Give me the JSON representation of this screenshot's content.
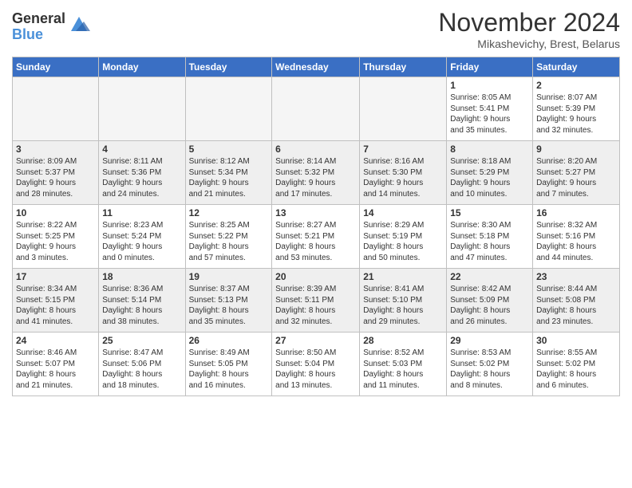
{
  "logo": {
    "general": "General",
    "blue": "Blue"
  },
  "header": {
    "month": "November 2024",
    "location": "Mikashevichy, Brest, Belarus"
  },
  "weekdays": [
    "Sunday",
    "Monday",
    "Tuesday",
    "Wednesday",
    "Thursday",
    "Friday",
    "Saturday"
  ],
  "weeks": [
    [
      {
        "day": "",
        "info": ""
      },
      {
        "day": "",
        "info": ""
      },
      {
        "day": "",
        "info": ""
      },
      {
        "day": "",
        "info": ""
      },
      {
        "day": "",
        "info": ""
      },
      {
        "day": "1",
        "info": "Sunrise: 8:05 AM\nSunset: 5:41 PM\nDaylight: 9 hours\nand 35 minutes."
      },
      {
        "day": "2",
        "info": "Sunrise: 8:07 AM\nSunset: 5:39 PM\nDaylight: 9 hours\nand 32 minutes."
      }
    ],
    [
      {
        "day": "3",
        "info": "Sunrise: 8:09 AM\nSunset: 5:37 PM\nDaylight: 9 hours\nand 28 minutes."
      },
      {
        "day": "4",
        "info": "Sunrise: 8:11 AM\nSunset: 5:36 PM\nDaylight: 9 hours\nand 24 minutes."
      },
      {
        "day": "5",
        "info": "Sunrise: 8:12 AM\nSunset: 5:34 PM\nDaylight: 9 hours\nand 21 minutes."
      },
      {
        "day": "6",
        "info": "Sunrise: 8:14 AM\nSunset: 5:32 PM\nDaylight: 9 hours\nand 17 minutes."
      },
      {
        "day": "7",
        "info": "Sunrise: 8:16 AM\nSunset: 5:30 PM\nDaylight: 9 hours\nand 14 minutes."
      },
      {
        "day": "8",
        "info": "Sunrise: 8:18 AM\nSunset: 5:29 PM\nDaylight: 9 hours\nand 10 minutes."
      },
      {
        "day": "9",
        "info": "Sunrise: 8:20 AM\nSunset: 5:27 PM\nDaylight: 9 hours\nand 7 minutes."
      }
    ],
    [
      {
        "day": "10",
        "info": "Sunrise: 8:22 AM\nSunset: 5:25 PM\nDaylight: 9 hours\nand 3 minutes."
      },
      {
        "day": "11",
        "info": "Sunrise: 8:23 AM\nSunset: 5:24 PM\nDaylight: 9 hours\nand 0 minutes."
      },
      {
        "day": "12",
        "info": "Sunrise: 8:25 AM\nSunset: 5:22 PM\nDaylight: 8 hours\nand 57 minutes."
      },
      {
        "day": "13",
        "info": "Sunrise: 8:27 AM\nSunset: 5:21 PM\nDaylight: 8 hours\nand 53 minutes."
      },
      {
        "day": "14",
        "info": "Sunrise: 8:29 AM\nSunset: 5:19 PM\nDaylight: 8 hours\nand 50 minutes."
      },
      {
        "day": "15",
        "info": "Sunrise: 8:30 AM\nSunset: 5:18 PM\nDaylight: 8 hours\nand 47 minutes."
      },
      {
        "day": "16",
        "info": "Sunrise: 8:32 AM\nSunset: 5:16 PM\nDaylight: 8 hours\nand 44 minutes."
      }
    ],
    [
      {
        "day": "17",
        "info": "Sunrise: 8:34 AM\nSunset: 5:15 PM\nDaylight: 8 hours\nand 41 minutes."
      },
      {
        "day": "18",
        "info": "Sunrise: 8:36 AM\nSunset: 5:14 PM\nDaylight: 8 hours\nand 38 minutes."
      },
      {
        "day": "19",
        "info": "Sunrise: 8:37 AM\nSunset: 5:13 PM\nDaylight: 8 hours\nand 35 minutes."
      },
      {
        "day": "20",
        "info": "Sunrise: 8:39 AM\nSunset: 5:11 PM\nDaylight: 8 hours\nand 32 minutes."
      },
      {
        "day": "21",
        "info": "Sunrise: 8:41 AM\nSunset: 5:10 PM\nDaylight: 8 hours\nand 29 minutes."
      },
      {
        "day": "22",
        "info": "Sunrise: 8:42 AM\nSunset: 5:09 PM\nDaylight: 8 hours\nand 26 minutes."
      },
      {
        "day": "23",
        "info": "Sunrise: 8:44 AM\nSunset: 5:08 PM\nDaylight: 8 hours\nand 23 minutes."
      }
    ],
    [
      {
        "day": "24",
        "info": "Sunrise: 8:46 AM\nSunset: 5:07 PM\nDaylight: 8 hours\nand 21 minutes."
      },
      {
        "day": "25",
        "info": "Sunrise: 8:47 AM\nSunset: 5:06 PM\nDaylight: 8 hours\nand 18 minutes."
      },
      {
        "day": "26",
        "info": "Sunrise: 8:49 AM\nSunset: 5:05 PM\nDaylight: 8 hours\nand 16 minutes."
      },
      {
        "day": "27",
        "info": "Sunrise: 8:50 AM\nSunset: 5:04 PM\nDaylight: 8 hours\nand 13 minutes."
      },
      {
        "day": "28",
        "info": "Sunrise: 8:52 AM\nSunset: 5:03 PM\nDaylight: 8 hours\nand 11 minutes."
      },
      {
        "day": "29",
        "info": "Sunrise: 8:53 AM\nSunset: 5:02 PM\nDaylight: 8 hours\nand 8 minutes."
      },
      {
        "day": "30",
        "info": "Sunrise: 8:55 AM\nSunset: 5:02 PM\nDaylight: 8 hours\nand 6 minutes."
      }
    ]
  ]
}
